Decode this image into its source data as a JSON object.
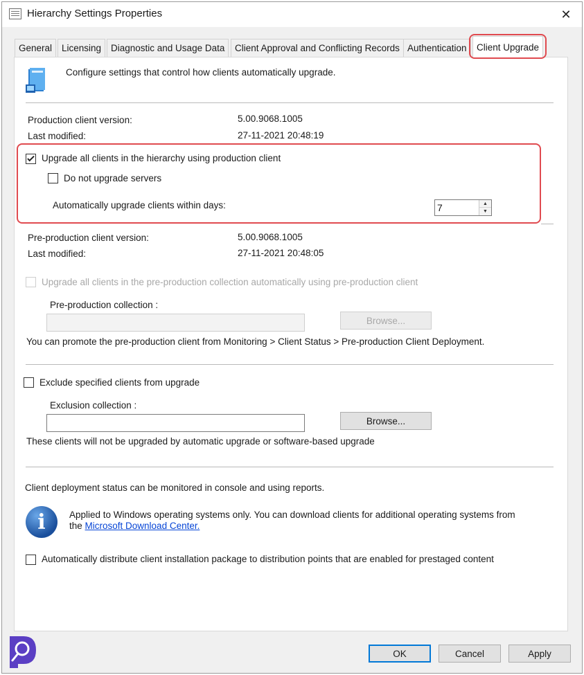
{
  "window": {
    "title": "Hierarchy Settings Properties",
    "close_glyph": "✕"
  },
  "tabs": [
    {
      "label": "General"
    },
    {
      "label": "Licensing"
    },
    {
      "label": "Diagnostic and Usage Data"
    },
    {
      "label": "Client Approval and Conflicting Records"
    },
    {
      "label": "Authentication"
    },
    {
      "label": "Client Upgrade",
      "active": true
    }
  ],
  "header": {
    "description": "Configure settings that control how clients automatically upgrade.",
    "icon": "client-upgrade-icon"
  },
  "production": {
    "version_label": "Production client version:",
    "version_value": "5.00.9068.1005",
    "modified_label": "Last modified:",
    "modified_value": "27-11-2021 20:48:19",
    "upgrade_all_label": "Upgrade all clients in the hierarchy using production client",
    "upgrade_all_checked": true,
    "no_servers_label": "Do not upgrade servers",
    "no_servers_checked": false,
    "within_days_label": "Automatically upgrade clients within days:",
    "within_days_value": "7"
  },
  "preproduction": {
    "version_label": "Pre-production client version:",
    "version_value": "5.00.9068.1005",
    "modified_label": "Last modified:",
    "modified_value": "27-11-2021 20:48:05",
    "upgrade_label": "Upgrade all clients in the pre-production collection automatically using pre-production client",
    "collection_label": "Pre-production collection :",
    "browse_label": "Browse...",
    "promote_text": "You can promote the pre-production client from Monitoring > Client Status > Pre-production Client Deployment."
  },
  "exclusion": {
    "exclude_label": "Exclude specified clients from upgrade",
    "collection_label": "Exclusion collection :",
    "browse_label": "Browse...",
    "note": "These clients will not be upgraded by automatic upgrade or software-based upgrade"
  },
  "deployment": {
    "status_text": "Client deployment status can be monitored in console and using reports.",
    "info_line1": "Applied to Windows operating systems only. You can download clients for additional operating systems from",
    "info_line2_prefix": "the ",
    "info_link": "Microsoft Download Center.",
    "distribute_label": "Automatically distribute client installation package to distribution points that are enabled for prestaged content"
  },
  "footer": {
    "ok": "OK",
    "cancel": "Cancel",
    "apply": "Apply"
  },
  "colors": {
    "highlight": "#e04a4f",
    "link": "#0645d6",
    "accent": "#0078d7"
  }
}
